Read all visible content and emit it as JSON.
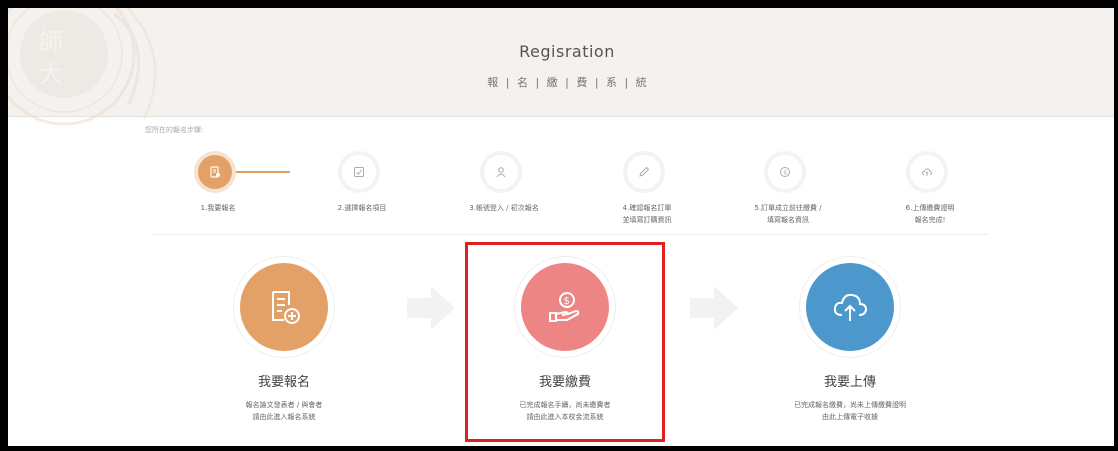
{
  "header": {
    "title": "Regisration",
    "subtitle": "報 | 名 | 繳 | 費 | 系 | 統",
    "seal_text": "師大"
  },
  "steps_heading": "您所在的報名步驟:",
  "steps": [
    {
      "label": "1.我要報名",
      "icon": "document-icon",
      "active": true
    },
    {
      "label": "2.選擇報名項目",
      "icon": "checkbox-icon",
      "active": false
    },
    {
      "label": "3.帳號登入 / 初次報名",
      "icon": "user-icon",
      "active": false
    },
    {
      "label": "4.確認報名訂單\n並填寫訂購資訊",
      "icon": "pencil-icon",
      "active": false
    },
    {
      "label": "5.訂單成立前往繳費 /\n填寫報名資訊",
      "icon": "dollar-icon",
      "active": false
    },
    {
      "label": "6.上傳繳費證明\n報名完成!",
      "icon": "cloud-upload-icon",
      "active": false
    }
  ],
  "cards": [
    {
      "title": "我要報名",
      "desc_line1": "報名論文發表者 / 與會者",
      "desc_line2": "請由此進入報名系統",
      "icon": "document-add-icon",
      "color": "#e3a067"
    },
    {
      "title": "我要繳費",
      "desc_line1": "已完成報名手續，尚未繳費者",
      "desc_line2": "請由此進入本校金流系統",
      "icon": "hand-coin-icon",
      "color": "#ee8585"
    },
    {
      "title": "我要上傳",
      "desc_line1": "已完成報名繳費，尚未上傳繳費證明",
      "desc_line2": "由此上傳電子收據",
      "icon": "cloud-upload-icon",
      "color": "#4c98cd"
    }
  ],
  "colors": {
    "accent": "#e3a067",
    "highlight": "#e12020"
  }
}
